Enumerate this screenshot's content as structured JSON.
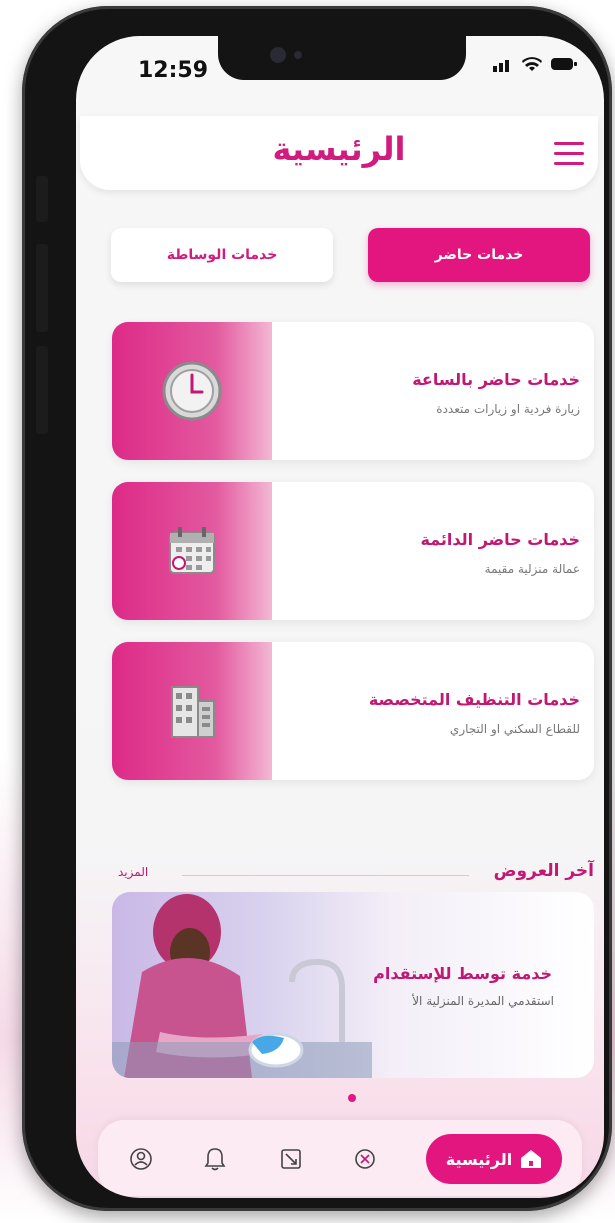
{
  "status_bar": {
    "time": "12:59"
  },
  "header": {
    "title": "الرئيسية"
  },
  "tabs": [
    {
      "label": "خدمات حاضر",
      "active": true
    },
    {
      "label": "خدمات الوساطة",
      "active": false
    }
  ],
  "services": [
    {
      "title": "خدمات حاضر بالساعة",
      "subtitle": "زيارة فردية او زيارات متعددة",
      "icon": "clock-icon"
    },
    {
      "title": "خدمات حاضر الدائمة",
      "subtitle": "عمالة منزلية مقيمة",
      "icon": "calendar-icon"
    },
    {
      "title": "خدمات التنظيف المتخصصة",
      "subtitle": "للقطاع السكني او التجاري",
      "icon": "building-icon"
    }
  ],
  "offers": {
    "title": "آخر العروض",
    "more_label": "المزيد",
    "banner": {
      "title": "خدمة توسط للإستقدام",
      "subtitle": "استقدمي المديرة المنزلية الأ"
    }
  },
  "bottom_nav": {
    "home_label": "الرئيسية",
    "items": [
      "home-icon",
      "services-icon",
      "orders-icon",
      "bell-icon",
      "profile-icon"
    ]
  },
  "colors": {
    "accent": "#e3167f",
    "accent_dark": "#c21773"
  }
}
